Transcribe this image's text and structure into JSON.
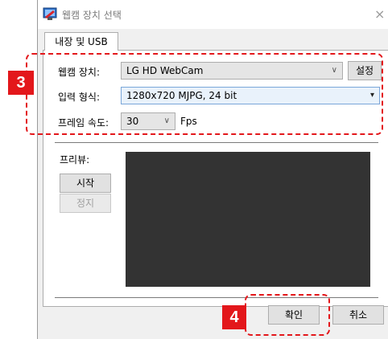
{
  "window": {
    "title": "웹캠 장치 선택",
    "close_glyph": "×"
  },
  "tabs": [
    {
      "label": "내장 및 USB"
    }
  ],
  "form": {
    "device_label": "웹캠 장치:",
    "device_value": "LG HD WebCam",
    "settings_button": "설정",
    "format_label": "입력 형식:",
    "format_value": "1280x720 MJPG, 24 bit",
    "framerate_label": "프레임 속도:",
    "framerate_value": "30",
    "framerate_unit": "Fps"
  },
  "preview": {
    "label": "프리뷰:",
    "start_button": "시작",
    "stop_button": "정지"
  },
  "footer": {
    "ok_button": "확인",
    "cancel_button": "취소"
  },
  "annotations": [
    {
      "number": "3",
      "color": "#e3171b"
    },
    {
      "number": "4",
      "color": "#e3171b"
    }
  ],
  "icons": {
    "dropdown": "chevron-down-icon",
    "app": "webcam-app-icon"
  }
}
